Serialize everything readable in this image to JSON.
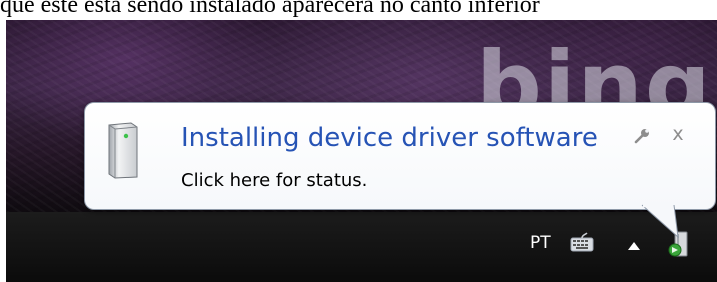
{
  "document": {
    "caption": "que este está sendo instalado aparecerá no canto inferior"
  },
  "wallpaper": {
    "logo_text": "bing"
  },
  "balloon": {
    "title": "Installing device driver software",
    "message": "Click here for status.",
    "close_symbol": "x",
    "icons": {
      "device": "device-tower-icon",
      "options": "wrench-icon",
      "close": "close-icon"
    },
    "title_color": "#2653b5"
  },
  "taskbar": {
    "language": "PT",
    "tray_icons": [
      "keyboard-icon",
      "show-hidden-icons-arrow",
      "device-install-icon"
    ]
  }
}
